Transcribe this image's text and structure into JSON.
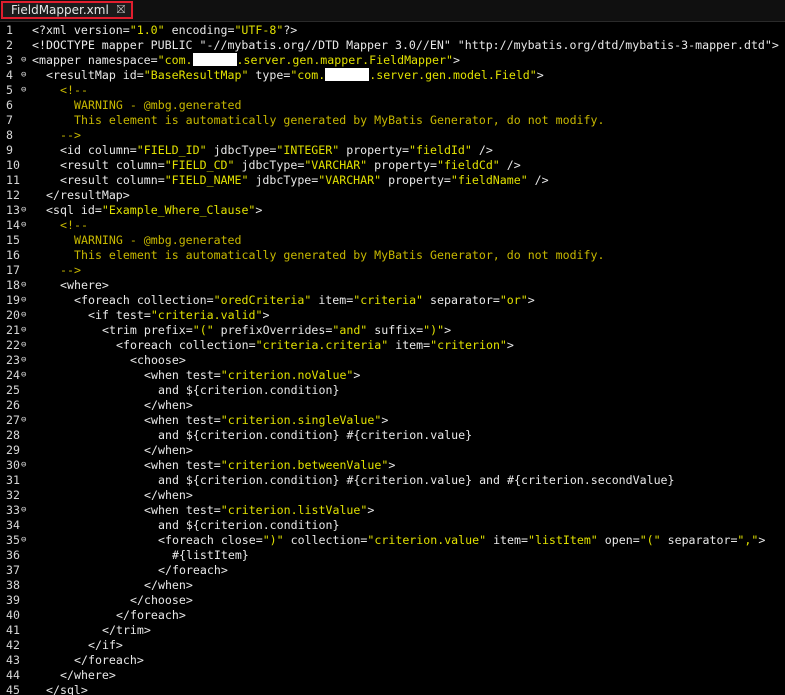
{
  "tab": {
    "title": "FieldMapper.xml",
    "close_glyph": "⛝"
  },
  "colors": {
    "tag": "#e8e8e8",
    "string": "#e0e000",
    "comment": "#c7b800",
    "background": "#000000"
  },
  "lines": [
    {
      "n": "1",
      "fold": false,
      "indent": 0,
      "segs": [
        [
          "tag",
          "<?xml version="
        ],
        [
          "str",
          "\"1.0\""
        ],
        [
          "tag",
          " encoding="
        ],
        [
          "str",
          "\"UTF-8\""
        ],
        [
          "tag",
          "?>"
        ]
      ]
    },
    {
      "n": "2",
      "fold": false,
      "indent": 0,
      "segs": [
        [
          "tag",
          "<!DOCTYPE mapper PUBLIC \"-//mybatis.org//DTD Mapper 3.0//EN\" \"http://mybatis.org/dtd/mybatis-3-mapper.dtd\">"
        ]
      ]
    },
    {
      "n": "3",
      "fold": true,
      "indent": 0,
      "segs": [
        [
          "tag",
          "<mapper namespace="
        ],
        [
          "str",
          "\"com."
        ],
        [
          "redact",
          ""
        ],
        [
          "str",
          ".server.gen.mapper.FieldMapper\""
        ],
        [
          "tag",
          ">"
        ]
      ]
    },
    {
      "n": "4",
      "fold": true,
      "indent": 1,
      "segs": [
        [
          "tag",
          "<resultMap id="
        ],
        [
          "str",
          "\"BaseResultMap\""
        ],
        [
          "tag",
          " type="
        ],
        [
          "str",
          "\"com."
        ],
        [
          "redact",
          ""
        ],
        [
          "str",
          ".server.gen.model.Field\""
        ],
        [
          "tag",
          ">"
        ]
      ]
    },
    {
      "n": "5",
      "fold": true,
      "indent": 2,
      "segs": [
        [
          "cmt",
          "<!--"
        ]
      ]
    },
    {
      "n": "6",
      "fold": false,
      "indent": 3,
      "segs": [
        [
          "cmt",
          "WARNING - @mbg.generated"
        ]
      ]
    },
    {
      "n": "7",
      "fold": false,
      "indent": 3,
      "segs": [
        [
          "cmt",
          "This element is automatically generated by MyBatis Generator, do not modify."
        ]
      ]
    },
    {
      "n": "8",
      "fold": false,
      "indent": 2,
      "segs": [
        [
          "cmt",
          "-->"
        ]
      ]
    },
    {
      "n": "9",
      "fold": false,
      "indent": 2,
      "segs": [
        [
          "tag",
          "<id column="
        ],
        [
          "str",
          "\"FIELD_ID\""
        ],
        [
          "tag",
          " jdbcType="
        ],
        [
          "str",
          "\"INTEGER\""
        ],
        [
          "tag",
          " property="
        ],
        [
          "str",
          "\"fieldId\""
        ],
        [
          "tag",
          " />"
        ]
      ]
    },
    {
      "n": "10",
      "fold": false,
      "indent": 2,
      "segs": [
        [
          "tag",
          "<result column="
        ],
        [
          "str",
          "\"FIELD_CD\""
        ],
        [
          "tag",
          " jdbcType="
        ],
        [
          "str",
          "\"VARCHAR\""
        ],
        [
          "tag",
          " property="
        ],
        [
          "str",
          "\"fieldCd\""
        ],
        [
          "tag",
          " />"
        ]
      ]
    },
    {
      "n": "11",
      "fold": false,
      "indent": 2,
      "segs": [
        [
          "tag",
          "<result column="
        ],
        [
          "str",
          "\"FIELD_NAME\""
        ],
        [
          "tag",
          " jdbcType="
        ],
        [
          "str",
          "\"VARCHAR\""
        ],
        [
          "tag",
          " property="
        ],
        [
          "str",
          "\"fieldName\""
        ],
        [
          "tag",
          " />"
        ]
      ]
    },
    {
      "n": "12",
      "fold": false,
      "indent": 1,
      "segs": [
        [
          "tag",
          "</resultMap>"
        ]
      ]
    },
    {
      "n": "13",
      "fold": true,
      "indent": 1,
      "segs": [
        [
          "tag",
          "<sql id="
        ],
        [
          "str",
          "\"Example_Where_Clause\""
        ],
        [
          "tag",
          ">"
        ]
      ]
    },
    {
      "n": "14",
      "fold": true,
      "indent": 2,
      "segs": [
        [
          "cmt",
          "<!--"
        ]
      ]
    },
    {
      "n": "15",
      "fold": false,
      "indent": 3,
      "segs": [
        [
          "cmt",
          "WARNING - @mbg.generated"
        ]
      ]
    },
    {
      "n": "16",
      "fold": false,
      "indent": 3,
      "segs": [
        [
          "cmt",
          "This element is automatically generated by MyBatis Generator, do not modify."
        ]
      ]
    },
    {
      "n": "17",
      "fold": false,
      "indent": 2,
      "segs": [
        [
          "cmt",
          "-->"
        ]
      ]
    },
    {
      "n": "18",
      "fold": true,
      "indent": 2,
      "segs": [
        [
          "tag",
          "<where>"
        ]
      ]
    },
    {
      "n": "19",
      "fold": true,
      "indent": 3,
      "segs": [
        [
          "tag",
          "<foreach collection="
        ],
        [
          "str",
          "\"oredCriteria\""
        ],
        [
          "tag",
          " item="
        ],
        [
          "str",
          "\"criteria\""
        ],
        [
          "tag",
          " separator="
        ],
        [
          "str",
          "\"or\""
        ],
        [
          "tag",
          ">"
        ]
      ]
    },
    {
      "n": "20",
      "fold": true,
      "indent": 4,
      "segs": [
        [
          "tag",
          "<if test="
        ],
        [
          "str",
          "\"criteria.valid\""
        ],
        [
          "tag",
          ">"
        ]
      ]
    },
    {
      "n": "21",
      "fold": true,
      "indent": 5,
      "segs": [
        [
          "tag",
          "<trim prefix="
        ],
        [
          "str",
          "\"(\""
        ],
        [
          "tag",
          " prefixOverrides="
        ],
        [
          "str",
          "\"and\""
        ],
        [
          "tag",
          " suffix="
        ],
        [
          "str",
          "\")\""
        ],
        [
          "tag",
          ">"
        ]
      ]
    },
    {
      "n": "22",
      "fold": true,
      "indent": 6,
      "segs": [
        [
          "tag",
          "<foreach collection="
        ],
        [
          "str",
          "\"criteria.criteria\""
        ],
        [
          "tag",
          " item="
        ],
        [
          "str",
          "\"criterion\""
        ],
        [
          "tag",
          ">"
        ]
      ]
    },
    {
      "n": "23",
      "fold": true,
      "indent": 7,
      "segs": [
        [
          "tag",
          "<choose>"
        ]
      ]
    },
    {
      "n": "24",
      "fold": true,
      "indent": 8,
      "segs": [
        [
          "tag",
          "<when test="
        ],
        [
          "str",
          "\"criterion.noValue\""
        ],
        [
          "tag",
          ">"
        ]
      ]
    },
    {
      "n": "25",
      "fold": false,
      "indent": 9,
      "segs": [
        [
          "txt",
          "and ${criterion.condition}"
        ]
      ]
    },
    {
      "n": "26",
      "fold": false,
      "indent": 8,
      "segs": [
        [
          "tag",
          "</when>"
        ]
      ]
    },
    {
      "n": "27",
      "fold": true,
      "indent": 8,
      "segs": [
        [
          "tag",
          "<when test="
        ],
        [
          "str",
          "\"criterion.singleValue\""
        ],
        [
          "tag",
          ">"
        ]
      ]
    },
    {
      "n": "28",
      "fold": false,
      "indent": 9,
      "segs": [
        [
          "txt",
          "and ${criterion.condition} #{criterion.value}"
        ]
      ]
    },
    {
      "n": "29",
      "fold": false,
      "indent": 8,
      "segs": [
        [
          "tag",
          "</when>"
        ]
      ]
    },
    {
      "n": "30",
      "fold": true,
      "indent": 8,
      "segs": [
        [
          "tag",
          "<when test="
        ],
        [
          "str",
          "\"criterion.betweenValue\""
        ],
        [
          "tag",
          ">"
        ]
      ]
    },
    {
      "n": "31",
      "fold": false,
      "indent": 9,
      "segs": [
        [
          "txt",
          "and ${criterion.condition} #{criterion.value} and #{criterion.secondValue}"
        ]
      ]
    },
    {
      "n": "32",
      "fold": false,
      "indent": 8,
      "segs": [
        [
          "tag",
          "</when>"
        ]
      ]
    },
    {
      "n": "33",
      "fold": true,
      "indent": 8,
      "segs": [
        [
          "tag",
          "<when test="
        ],
        [
          "str",
          "\"criterion.listValue\""
        ],
        [
          "tag",
          ">"
        ]
      ]
    },
    {
      "n": "34",
      "fold": false,
      "indent": 9,
      "segs": [
        [
          "txt",
          "and ${criterion.condition}"
        ]
      ]
    },
    {
      "n": "35",
      "fold": true,
      "indent": 9,
      "segs": [
        [
          "tag",
          "<foreach close="
        ],
        [
          "str",
          "\")\""
        ],
        [
          "tag",
          " collection="
        ],
        [
          "str",
          "\"criterion.value\""
        ],
        [
          "tag",
          " item="
        ],
        [
          "str",
          "\"listItem\""
        ],
        [
          "tag",
          " open="
        ],
        [
          "str",
          "\"(\""
        ],
        [
          "tag",
          " separator="
        ],
        [
          "str",
          "\",\""
        ],
        [
          "tag",
          ">"
        ]
      ]
    },
    {
      "n": "36",
      "fold": false,
      "indent": 10,
      "segs": [
        [
          "txt",
          "#{listItem}"
        ]
      ]
    },
    {
      "n": "37",
      "fold": false,
      "indent": 9,
      "segs": [
        [
          "tag",
          "</foreach>"
        ]
      ]
    },
    {
      "n": "38",
      "fold": false,
      "indent": 8,
      "segs": [
        [
          "tag",
          "</when>"
        ]
      ]
    },
    {
      "n": "39",
      "fold": false,
      "indent": 7,
      "segs": [
        [
          "tag",
          "</choose>"
        ]
      ]
    },
    {
      "n": "40",
      "fold": false,
      "indent": 6,
      "segs": [
        [
          "tag",
          "</foreach>"
        ]
      ]
    },
    {
      "n": "41",
      "fold": false,
      "indent": 5,
      "segs": [
        [
          "tag",
          "</trim>"
        ]
      ]
    },
    {
      "n": "42",
      "fold": false,
      "indent": 4,
      "segs": [
        [
          "tag",
          "</if>"
        ]
      ]
    },
    {
      "n": "43",
      "fold": false,
      "indent": 3,
      "segs": [
        [
          "tag",
          "</foreach>"
        ]
      ]
    },
    {
      "n": "44",
      "fold": false,
      "indent": 2,
      "segs": [
        [
          "tag",
          "</where>"
        ]
      ]
    },
    {
      "n": "45",
      "fold": false,
      "indent": 1,
      "segs": [
        [
          "tag",
          "</sql>"
        ]
      ]
    }
  ]
}
